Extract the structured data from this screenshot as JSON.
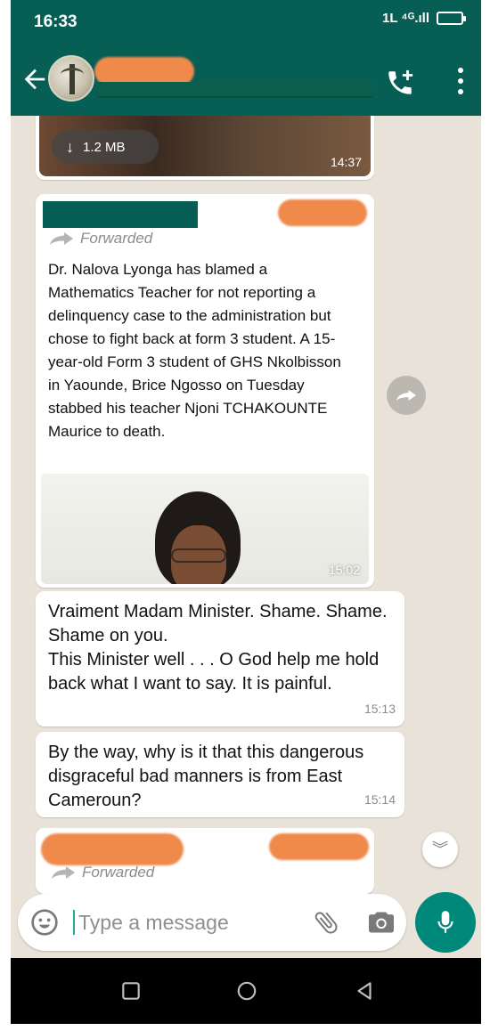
{
  "status_bar": {
    "time": "16:33",
    "network": "1L ⁴ᴳ.ıll"
  },
  "video_message": {
    "size": "1.2 MB",
    "time": "14:37"
  },
  "news_message": {
    "forwarded_label": "Forwarded",
    "text": "Dr. Nalova Lyonga has blamed a Mathematics Teacher for not reporting a delinquency case to the administration but chose to fight back at form 3 student. A 15-year-old Form 3 student of GHS Nkolbisson in Yaounde, Brice Ngosso on Tuesday stabbed his teacher Njoni TCHAKOUNTE Maurice to death.",
    "time": "15:02"
  },
  "messages": [
    {
      "text": "Vraiment Madam Minister. Shame. Shame. Shame on you.\nThis Minister well . . . O God help me hold back what I want to say. It is painful.",
      "time": "15:13"
    },
    {
      "text": "By the way, why is it that this dangerous disgraceful bad manners is from East Cameroun?",
      "time": "15:14"
    }
  ],
  "bottom_message": {
    "forwarded_label": "Forwarded"
  },
  "composer": {
    "placeholder": "Type a message"
  },
  "colors": {
    "header": "#075e54",
    "accent": "#00897b",
    "redaction": "#f08a4b"
  },
  "icons": [
    "back-arrow-icon",
    "add-call-icon",
    "more-options-icon",
    "download-icon",
    "forward-icon",
    "share-icon",
    "scroll-down-icon",
    "emoji-icon",
    "attach-icon",
    "camera-icon",
    "mic-icon",
    "nav-recents-icon",
    "nav-home-icon",
    "nav-back-icon"
  ]
}
